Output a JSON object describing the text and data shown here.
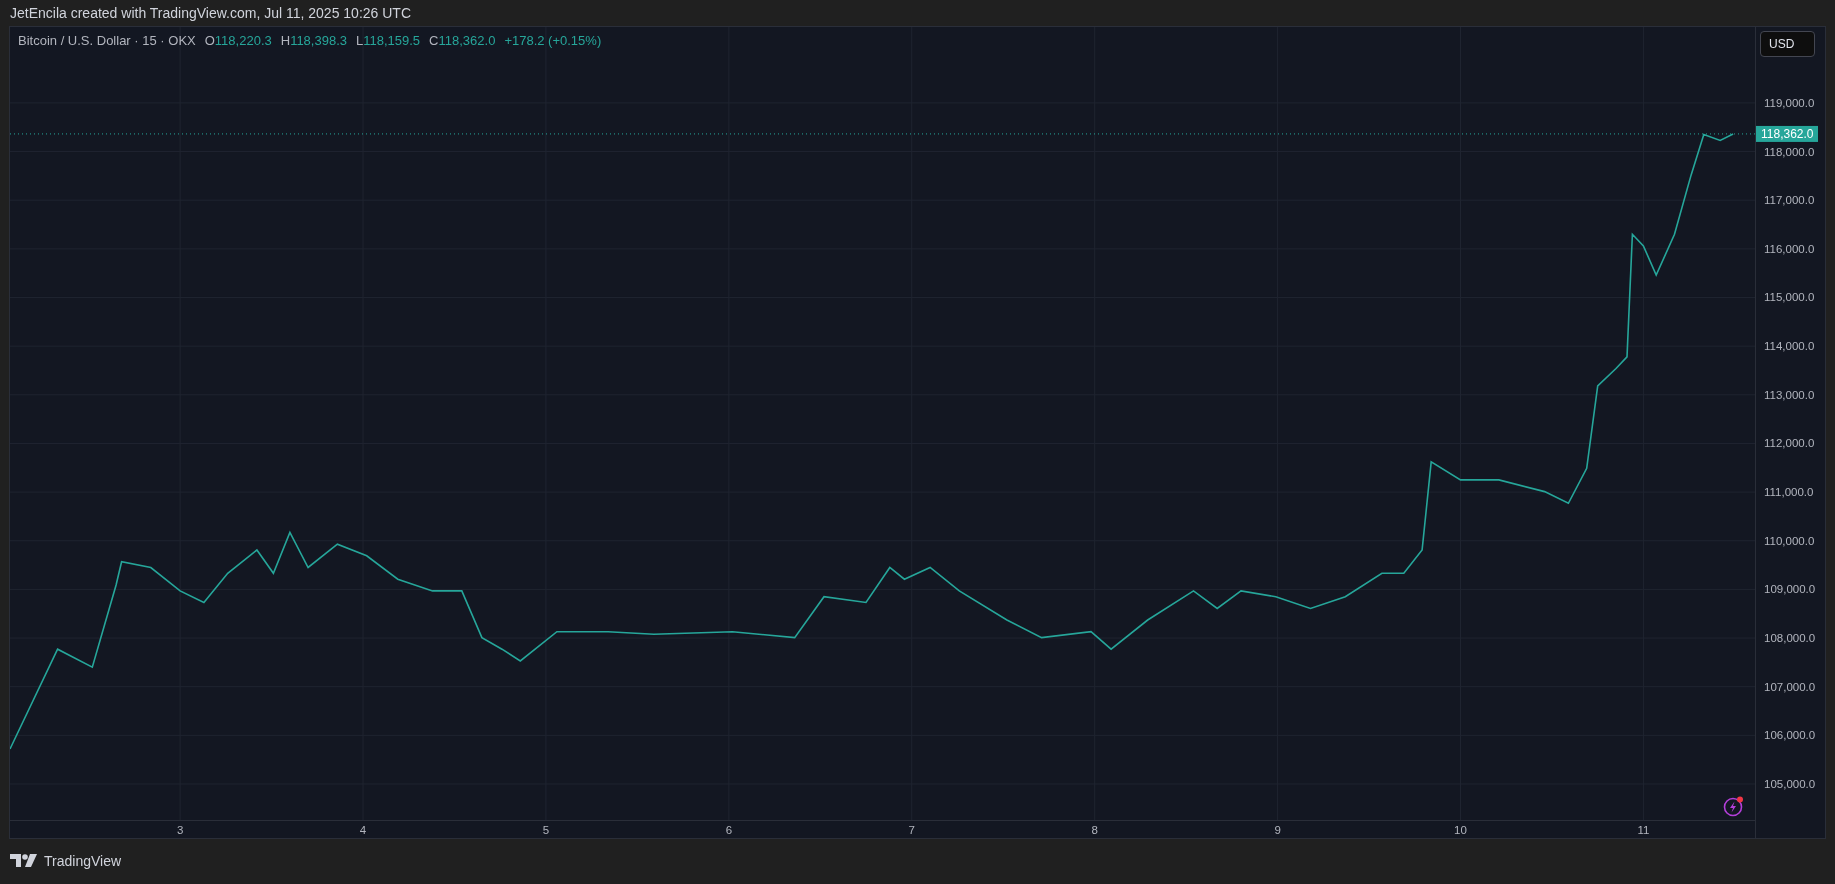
{
  "attribution": "JetEncila created with TradingView.com, Jul 11, 2025 10:26 UTC",
  "legend": {
    "symbol": "Bitcoin / U.S. Dollar · 15 · OKX",
    "ohlc": [
      {
        "label": "O",
        "value": "118,220.3"
      },
      {
        "label": "H",
        "value": "118,398.3"
      },
      {
        "label": "L",
        "value": "118,159.5"
      },
      {
        "label": "C",
        "value": "118,362.0"
      }
    ],
    "change": "+178.2 (+0.15%)"
  },
  "currency_button": "USD",
  "chart": {
    "chart_data": {
      "type": "line",
      "x": [
        2.07,
        2.33,
        2.52,
        2.65,
        2.68,
        2.84,
        3.0,
        3.13,
        3.26,
        3.42,
        3.51,
        3.6,
        3.7,
        3.86,
        4.02,
        4.19,
        4.38,
        4.54,
        4.65,
        4.76,
        4.86,
        5.06,
        5.34,
        5.59,
        6.02,
        6.36,
        6.52,
        6.75,
        6.88,
        6.96,
        7.1,
        7.26,
        7.52,
        7.71,
        7.98,
        8.09,
        8.29,
        8.54,
        8.67,
        8.8,
        8.99,
        9.18,
        9.37,
        9.57,
        9.69,
        9.79,
        9.84,
        10.0,
        10.21,
        10.46,
        10.59,
        10.69,
        10.75,
        10.85,
        10.91,
        10.94,
        11.0,
        11.07,
        11.17,
        11.26,
        11.33,
        11.42,
        11.49
      ],
      "series": [
        {
          "color": "#26a69a",
          "values": [
            105720,
            107770,
            107400,
            109090,
            109570,
            109450,
            108970,
            108730,
            109330,
            109810,
            109330,
            110170,
            109450,
            109930,
            109690,
            109210,
            108970,
            108970,
            108010,
            107770,
            107530,
            108130,
            108130,
            108080,
            108130,
            108010,
            108850,
            108730,
            109450,
            109210,
            109450,
            108970,
            108370,
            108010,
            108130,
            107770,
            108370,
            108970,
            108610,
            108970,
            108850,
            108610,
            108850,
            109330,
            109330,
            109810,
            111620,
            111250,
            111250,
            111010,
            110770,
            111490,
            113180,
            113540,
            113780,
            116300,
            116060,
            115460,
            116300,
            117510,
            118350,
            118230,
            118360
          ]
        }
      ],
      "xlim": [
        2.07,
        11.61
      ],
      "ylim": [
        104260,
        120560
      ],
      "xticks": [
        3,
        4,
        5,
        6,
        7,
        8,
        9,
        10,
        11
      ],
      "yticks": [
        {
          "value": 105000,
          "label": "105,000.0"
        },
        {
          "value": 106000,
          "label": "106,000.0"
        },
        {
          "value": 107000,
          "label": "107,000.0"
        },
        {
          "value": 108000,
          "label": "108,000.0"
        },
        {
          "value": 109000,
          "label": "109,000.0"
        },
        {
          "value": 110000,
          "label": "110,000.0"
        },
        {
          "value": 111000,
          "label": "111,000.0"
        },
        {
          "value": 112000,
          "label": "112,000.0"
        },
        {
          "value": 113000,
          "label": "113,000.0"
        },
        {
          "value": 114000,
          "label": "114,000.0"
        },
        {
          "value": 115000,
          "label": "115,000.0"
        },
        {
          "value": 116000,
          "label": "116,000.0"
        },
        {
          "value": 117000,
          "label": "117,000.0"
        },
        {
          "value": 118000,
          "label": "118,000.0"
        },
        {
          "value": 119000,
          "label": "119,000.0"
        }
      ],
      "grid": true,
      "ref_lines": [
        {
          "axis": "y",
          "value": 118362
        }
      ],
      "annotations": [
        "118,362.0"
      ]
    }
  },
  "brand": "TradingView"
}
